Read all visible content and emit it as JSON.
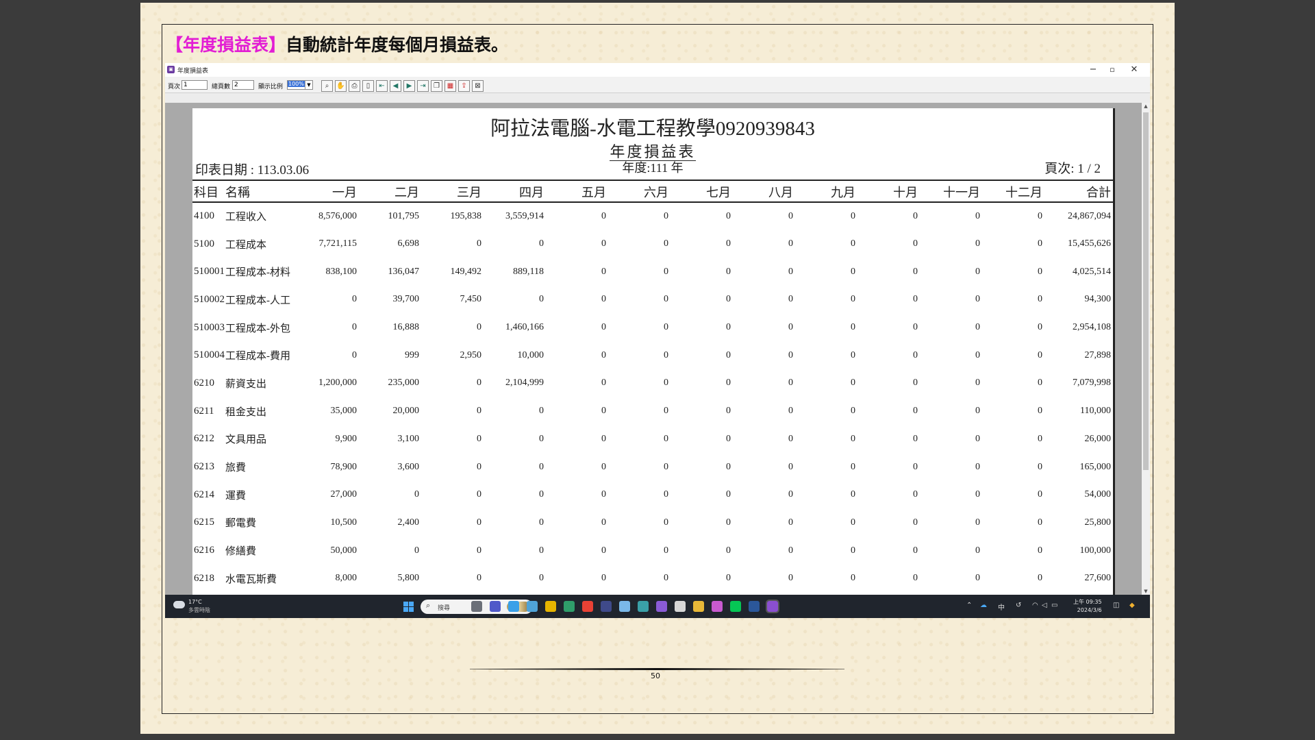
{
  "slide": {
    "heading_bracket": "【年度損益表】",
    "heading_text": "自動統計年度每個月損益表。",
    "page_number": "50"
  },
  "window": {
    "title": "年度損益表",
    "minimize": "−",
    "maximize": "▫",
    "close": "✕"
  },
  "toolbar": {
    "page_label": "頁次",
    "page_value": "1",
    "total_label": "總頁數",
    "total_value": "2",
    "zoom_label": "顯示比例",
    "zoom_value": "100%"
  },
  "report": {
    "company": "阿拉法電腦-水電工程教學0920939843",
    "title": "年度損益表",
    "year": "年度:111 年",
    "print_date": "印表日期 : 113.03.06",
    "page": "頁次: 1 / 2",
    "columns": [
      "科目",
      "名稱",
      "一月",
      "二月",
      "三月",
      "四月",
      "五月",
      "六月",
      "七月",
      "八月",
      "九月",
      "十月",
      "十一月",
      "十二月",
      "合計"
    ],
    "rows": [
      [
        "4100",
        "工程收入",
        "8,576,000",
        "101,795",
        "195,838",
        "3,559,914",
        "0",
        "0",
        "0",
        "0",
        "0",
        "0",
        "0",
        "0",
        "24,867,094"
      ],
      [
        "5100",
        "工程成本",
        "7,721,115",
        "6,698",
        "0",
        "0",
        "0",
        "0",
        "0",
        "0",
        "0",
        "0",
        "0",
        "0",
        "15,455,626"
      ],
      [
        "510001",
        "工程成本-材料",
        "838,100",
        "136,047",
        "149,492",
        "889,118",
        "0",
        "0",
        "0",
        "0",
        "0",
        "0",
        "0",
        "0",
        "4,025,514"
      ],
      [
        "510002",
        "工程成本-人工",
        "0",
        "39,700",
        "7,450",
        "0",
        "0",
        "0",
        "0",
        "0",
        "0",
        "0",
        "0",
        "0",
        "94,300"
      ],
      [
        "510003",
        "工程成本-外包",
        "0",
        "16,888",
        "0",
        "1,460,166",
        "0",
        "0",
        "0",
        "0",
        "0",
        "0",
        "0",
        "0",
        "2,954,108"
      ],
      [
        "510004",
        "工程成本-費用",
        "0",
        "999",
        "2,950",
        "10,000",
        "0",
        "0",
        "0",
        "0",
        "0",
        "0",
        "0",
        "0",
        "27,898"
      ],
      [
        "6210",
        "薪資支出",
        "1,200,000",
        "235,000",
        "0",
        "2,104,999",
        "0",
        "0",
        "0",
        "0",
        "0",
        "0",
        "0",
        "0",
        "7,079,998"
      ],
      [
        "6211",
        "租金支出",
        "35,000",
        "20,000",
        "0",
        "0",
        "0",
        "0",
        "0",
        "0",
        "0",
        "0",
        "0",
        "0",
        "110,000"
      ],
      [
        "6212",
        "文具用品",
        "9,900",
        "3,100",
        "0",
        "0",
        "0",
        "0",
        "0",
        "0",
        "0",
        "0",
        "0",
        "0",
        "26,000"
      ],
      [
        "6213",
        "旅費",
        "78,900",
        "3,600",
        "0",
        "0",
        "0",
        "0",
        "0",
        "0",
        "0",
        "0",
        "0",
        "0",
        "165,000"
      ],
      [
        "6214",
        "運費",
        "27,000",
        "0",
        "0",
        "0",
        "0",
        "0",
        "0",
        "0",
        "0",
        "0",
        "0",
        "0",
        "54,000"
      ],
      [
        "6215",
        "郵電費",
        "10,500",
        "2,400",
        "0",
        "0",
        "0",
        "0",
        "0",
        "0",
        "0",
        "0",
        "0",
        "0",
        "25,800"
      ],
      [
        "6216",
        "修繕費",
        "50,000",
        "0",
        "0",
        "0",
        "0",
        "0",
        "0",
        "0",
        "0",
        "0",
        "0",
        "0",
        "100,000"
      ],
      [
        "6218",
        "水電瓦斯費",
        "8,000",
        "5,800",
        "0",
        "0",
        "0",
        "0",
        "0",
        "0",
        "0",
        "0",
        "0",
        "0",
        "27,600"
      ]
    ]
  },
  "taskbar": {
    "weather_temp": "17°C",
    "weather_text": "多雲時陰",
    "search_placeholder": "搜尋",
    "ime": "中",
    "time": "上午 09:35",
    "date": "2024/3/6",
    "icons": [
      "file-explorer-icon",
      "teams-icon",
      "notepad-icon",
      "photos-icon",
      "store-icon",
      "edge-icon",
      "chrome-icon",
      "app-icon",
      "image-viewer-icon",
      "edge-dev-icon",
      "visual-studio-icon",
      "snipping-tool-icon",
      "folder-icon",
      "paint-icon",
      "line-icon",
      "word-icon",
      "report-app-icon"
    ],
    "icon_colors": [
      "#6b6f78",
      "#5059c9",
      "#3aa0e8",
      "#4fa3d8",
      "#e6b400",
      "#2f9e6a",
      "#e94235",
      "#3f4a8a",
      "#7ab8e8",
      "#3aa0a8",
      "#8a5bd6",
      "#d7d7d7",
      "#e8b838",
      "#c85ad0",
      "#06c755",
      "#2b579a",
      "#8a4fd0"
    ]
  }
}
